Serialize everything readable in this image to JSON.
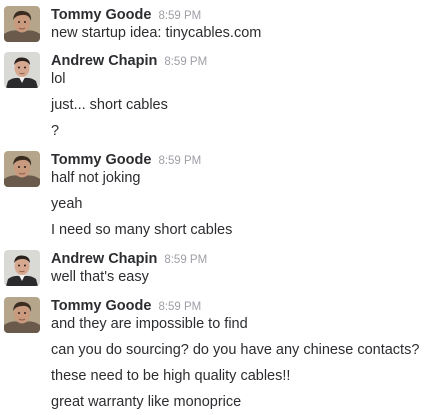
{
  "messages": [
    {
      "sender": "Tommy Goode",
      "time": "8:59 PM",
      "avatar": "tommy-avatar",
      "lines": [
        "new startup idea: tinycables.com"
      ]
    },
    {
      "sender": "Andrew Chapin",
      "time": "8:59 PM",
      "avatar": "andrew-avatar",
      "lines": [
        "lol",
        "just... short cables",
        "?"
      ]
    },
    {
      "sender": "Tommy Goode",
      "time": "8:59 PM",
      "avatar": "tommy-avatar",
      "lines": [
        "half not joking",
        "yeah",
        "I need so many short cables"
      ]
    },
    {
      "sender": "Andrew Chapin",
      "time": "8:59 PM",
      "avatar": "andrew-avatar",
      "lines": [
        "well that's easy"
      ]
    },
    {
      "sender": "Tommy Goode",
      "time": "8:59 PM",
      "avatar": "tommy-avatar",
      "lines": [
        "and they are impossible to find",
        "can you do sourcing? do you have any chinese contacts?",
        "these need to be high quality cables!!",
        "great warranty like monoprice"
      ]
    }
  ]
}
